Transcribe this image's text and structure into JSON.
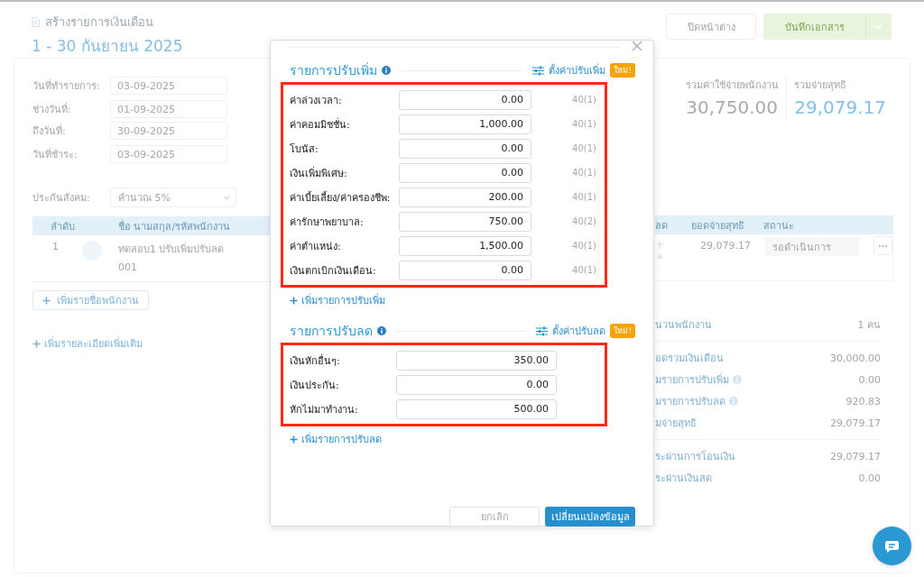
{
  "header": {
    "title": "สร้างรายการเงินเดือน",
    "period": "1 - 30 กันยายน 2025",
    "close_button": "ปิดหน้าต่าง",
    "save_button": "บันทึกเอกสาร"
  },
  "form": [
    {
      "label": "วันที่ทำรายการ:",
      "value": "03-09-2025"
    },
    {
      "label": "ช่วงวันที่:",
      "value": "01-09-2025"
    },
    {
      "label": "ถึงวันที่:",
      "value": "30-09-2025"
    },
    {
      "label": "วันที่ชำระ:",
      "value": "03-09-2025"
    }
  ],
  "social_security": {
    "label": "ประกันสังคม:",
    "value": "คำนวณ 5%"
  },
  "totals": [
    {
      "label": "รวมค่าใช้จ่ายพนักงาน",
      "value": "30,750.00",
      "kind": "plain"
    },
    {
      "label": "รวมจ่ายสุทธิ",
      "value": "29,079.17",
      "kind": "accent"
    }
  ],
  "table": {
    "columns": [
      "ลำดับ",
      "ชื่อ นามสกุล/รหัสพนักงาน",
      "ลด",
      "ยอดจ่ายสุทธิ",
      "สถานะ"
    ],
    "rows": [
      {
        "index": "1",
        "name": "ทดสอบ1 ปรับเพิ่มปรับลด",
        "code": "001",
        "net": "29,079.17",
        "status": "รอดำเนินการ"
      }
    ]
  },
  "add_employee": "เพิ่มรายชื่อพนักงาน",
  "add_details": "เพิ่มรายละเอียดเพิ่มเติม",
  "summary": [
    [
      {
        "label": "นวนพนักงาน",
        "value": "1 คน",
        "info": false
      }
    ],
    [
      {
        "label": "อดรวมเงินเดือน",
        "value": "30,000.00",
        "info": false
      },
      {
        "label": "มรายการปรับเพิ่ม",
        "value": "0.00",
        "info": true
      },
      {
        "label": "มรายการปรับลด",
        "value": "920.83",
        "info": true
      },
      {
        "label": "มจ่ายสุทธิ",
        "value": "29,079.17",
        "info": false
      }
    ],
    [
      {
        "label": "ระผ่านการโอนเงิน",
        "value": "29,079.17",
        "info": false
      },
      {
        "label": "ระผ่านเงินสด",
        "value": "0.00",
        "info": false
      }
    ]
  ],
  "modal": {
    "sections": [
      {
        "title": "รายการปรับเพิ่ม",
        "settings_link": "ตั้งค่าปรับเพิ่ม",
        "badge": "ใหม่!",
        "highlighted": true,
        "add_link": "เพิ่มรายการปรับเพิ่ม",
        "items": [
          {
            "label": "ค่าล่วงเวลา:",
            "value": "0.00",
            "tax_code": "40(1)"
          },
          {
            "label": "ค่าคอมมิชชั่น:",
            "value": "1,000.00",
            "tax_code": "40(1)"
          },
          {
            "label": "โบนัส:",
            "value": "0.00",
            "tax_code": "40(1)"
          },
          {
            "label": "เงินเพิ่มพิเศษ:",
            "value": "0.00",
            "tax_code": "40(1)"
          },
          {
            "label": "ค่าเบี้ยเลี้ยง/ค่าครองชีพ:",
            "value": "200.00",
            "tax_code": "40(1)"
          },
          {
            "label": "ค่ารักษาพยาบาล:",
            "value": "750.00",
            "tax_code": "40(2)"
          },
          {
            "label": "ค่าตำแหน่ง:",
            "value": "1,500.00",
            "tax_code": "40(1)"
          },
          {
            "label": "เงินตกเบิกเงินเดือน:",
            "value": "0.00",
            "tax_code": "40(1)"
          }
        ]
      },
      {
        "title": "รายการปรับลด",
        "settings_link": "ตั้งค่าปรับลด",
        "badge": "ใหม่!",
        "highlighted": true,
        "add_link": "เพิ่มรายการปรับลด",
        "items": [
          {
            "label": "เงินหักอื่นๆ:",
            "value": "350.00"
          },
          {
            "label": "เงินประกัน:",
            "value": "0.00"
          },
          {
            "label": "หักไม่มาทำงาน:",
            "value": "500.00"
          }
        ]
      }
    ],
    "cancel_button": "ยกเลิก",
    "submit_button": "เปลี่ยนแปลงข้อมูล"
  }
}
